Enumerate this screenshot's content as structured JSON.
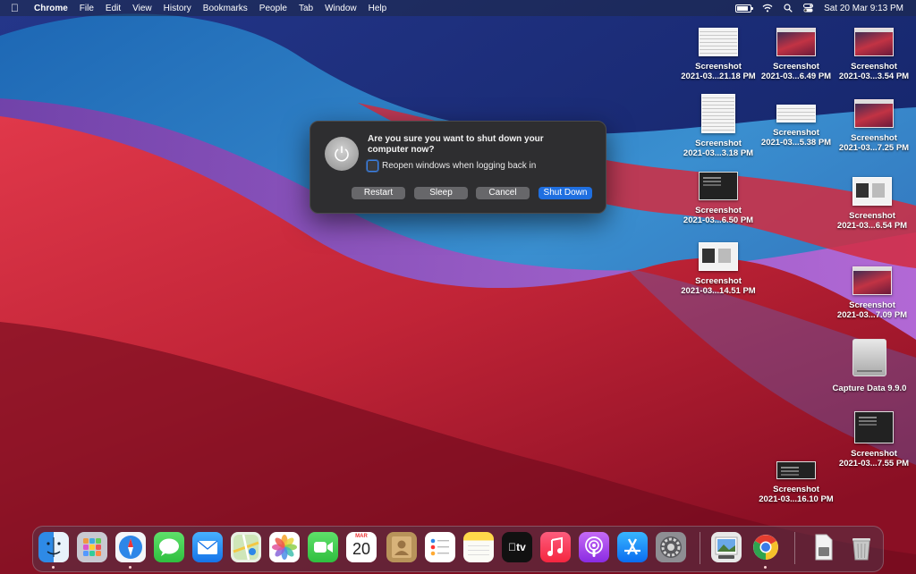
{
  "menubar": {
    "app_name": "Chrome",
    "items": [
      "File",
      "Edit",
      "View",
      "History",
      "Bookmarks",
      "People",
      "Tab",
      "Window",
      "Help"
    ],
    "clock": "Sat 20 Mar  9:13 PM"
  },
  "dialog": {
    "title": "Are you sure you want to shut down your computer now?",
    "checkbox_label": "Reopen windows when logging back in",
    "checkbox_checked": false,
    "buttons": {
      "restart": "Restart",
      "sleep": "Sleep",
      "cancel": "Cancel",
      "shutdown": "Shut Down"
    }
  },
  "desktop": {
    "icons": [
      {
        "line1": "Screenshot",
        "line2": "2021-03...21.18 PM"
      },
      {
        "line1": "Screenshot",
        "line2": "2021-03...6.49 PM"
      },
      {
        "line1": "Screenshot",
        "line2": "2021-03...3.54 PM"
      },
      {
        "line1": "Screenshot",
        "line2": "2021-03...3.18 PM"
      },
      {
        "line1": "Screenshot",
        "line2": "2021-03...5.38 PM"
      },
      {
        "line1": "Screenshot",
        "line2": "2021-03...7.25 PM"
      },
      {
        "line1": "Screenshot",
        "line2": "2021-03...6.50 PM"
      },
      {
        "line1": "Screenshot",
        "line2": "2021-03...6.54 PM"
      },
      {
        "line1": "Screenshot",
        "line2": "2021-03...14.51 PM"
      },
      {
        "line1": "Screenshot",
        "line2": "2021-03...7.09 PM"
      },
      {
        "line1": "Capture Data 9.9.0",
        "line2": ""
      },
      {
        "line1": "Screenshot",
        "line2": "2021-03...7.55 PM"
      },
      {
        "line1": "Screenshot",
        "line2": "2021-03...16.10 PM"
      }
    ]
  },
  "dock": {
    "calendar_month": "MAR",
    "calendar_day": "20",
    "tv_label": "tv",
    "apps": [
      "finder-icon",
      "launchpad-icon",
      "safari-icon",
      "messages-icon",
      "mail-icon",
      "maps-icon",
      "photos-icon",
      "facetime-icon",
      "calendar-icon",
      "contacts-icon",
      "reminders-icon",
      "notes-icon",
      "tv-icon",
      "music-icon",
      "podcasts-icon",
      "app-store-icon",
      "system-preferences-icon",
      "preview-icon",
      "chrome-icon",
      "downloads-icon",
      "trash-icon"
    ]
  }
}
